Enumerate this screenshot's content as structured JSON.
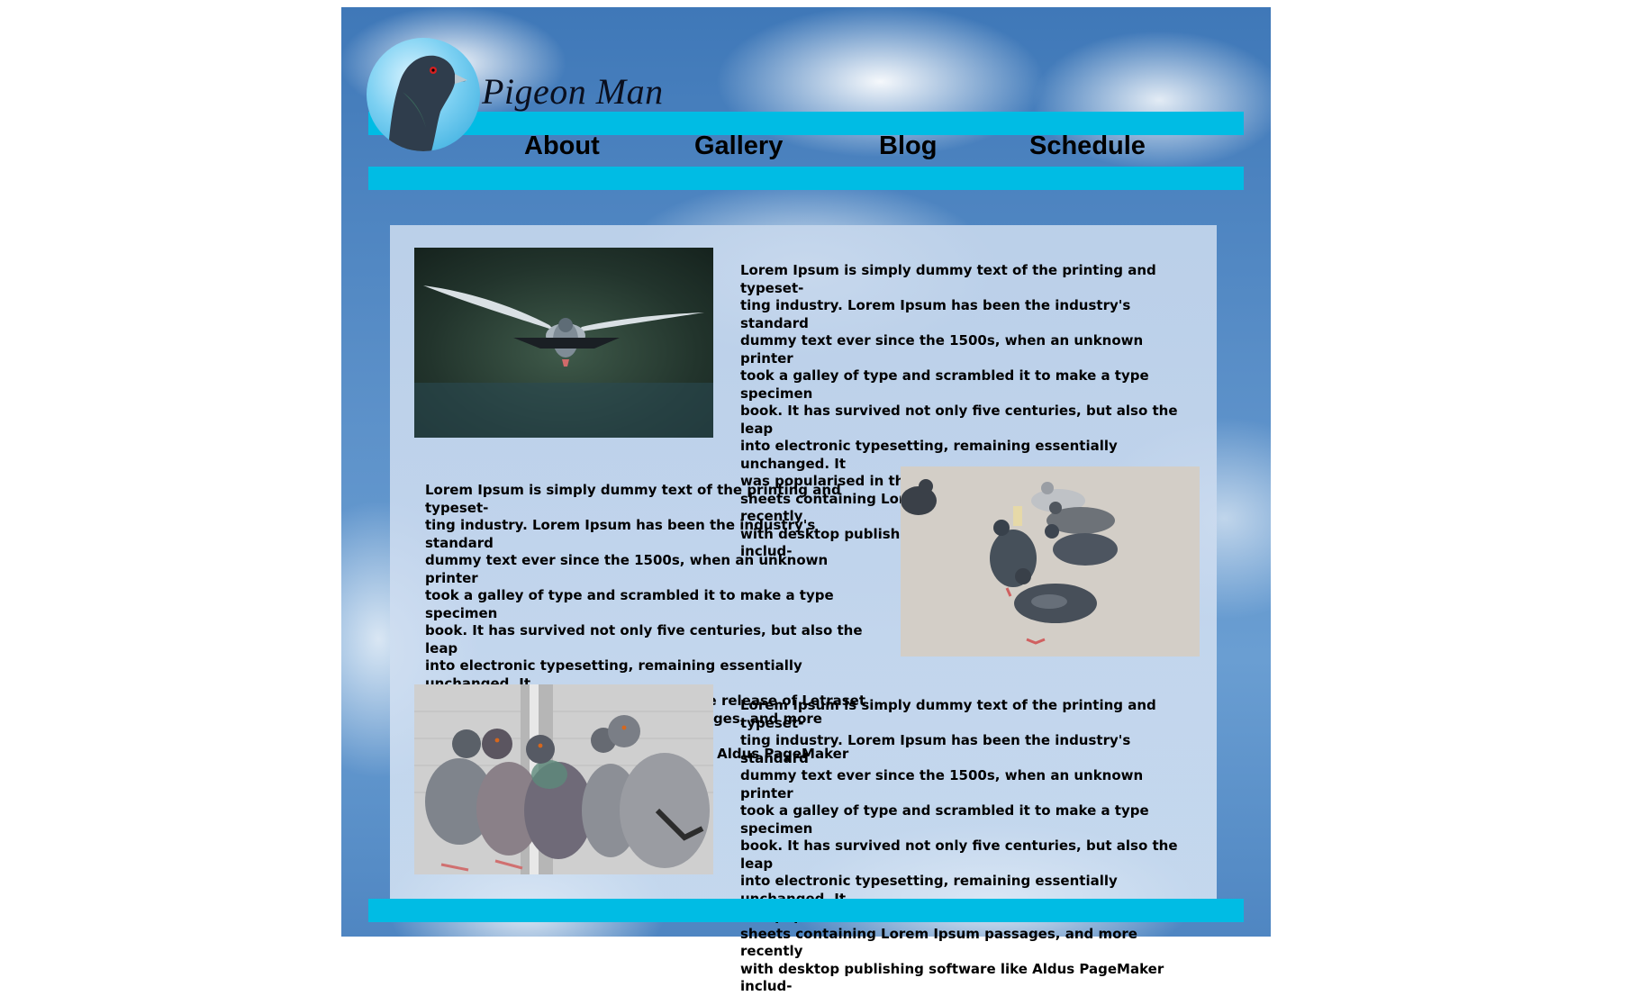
{
  "header": {
    "brand": "Pigeon Man",
    "logo_icon": "pigeon-head-icon"
  },
  "nav": {
    "items": [
      {
        "label": "About"
      },
      {
        "label": "Gallery"
      },
      {
        "label": "Blog"
      },
      {
        "label": "Schedule"
      }
    ]
  },
  "colors": {
    "accent_bar": "#00bce4",
    "sky_blue": "#4f86c2",
    "panel": "#c4d6ec"
  },
  "sections": [
    {
      "photo": "flying-pigeon-photo",
      "text": "Lorem Ipsum is simply dummy text of the printing and typeset-\nting industry. Lorem Ipsum has been the industry's standard\ndummy text ever since the 1500s, when an unknown printer\ntook a galley of type and scrambled it to make a type specimen\nbook. It has survived not only five centuries, but also the leap\ninto electronic typesetting, remaining essentially unchanged. It\nwas popularised in the 1960s with the release of Letraset\nsheets containing Lorem Ipsum passages, and more recently\nwith desktop publishing software like Aldus PageMaker includ-"
    },
    {
      "photo": "pigeons-on-ground-photo",
      "text": "Lorem Ipsum is simply dummy text of the printing and typeset-\nting industry. Lorem Ipsum has been the industry's standard\ndummy text ever since the 1500s, when an unknown printer\ntook a galley of type and scrambled it to make a type specimen\nbook. It has survived not only five centuries, but also the leap\ninto electronic typesetting, remaining essentially unchanged. It\nwas popularised in the 1960s with the release of Letraset\nsheets containing Lorem Ipsum passages, and more recently\nwith desktop publishing software like Aldus PageMaker includ-"
    },
    {
      "photo": "perched-pigeons-photo",
      "text": "Lorem Ipsum is simply dummy text of the printing and typeset-\nting industry. Lorem Ipsum has been the industry's standard\ndummy text ever since the 1500s, when an unknown printer\ntook a galley of type and scrambled it to make a type specimen\nbook. It has survived not only five centuries, but also the leap\ninto electronic typesetting, remaining essentially unchanged. It\nwas popularised in the 1960s with the release of Letraset\nsheets containing Lorem Ipsum passages, and more recently\nwith desktop publishing software like Aldus PageMaker includ-"
    }
  ]
}
